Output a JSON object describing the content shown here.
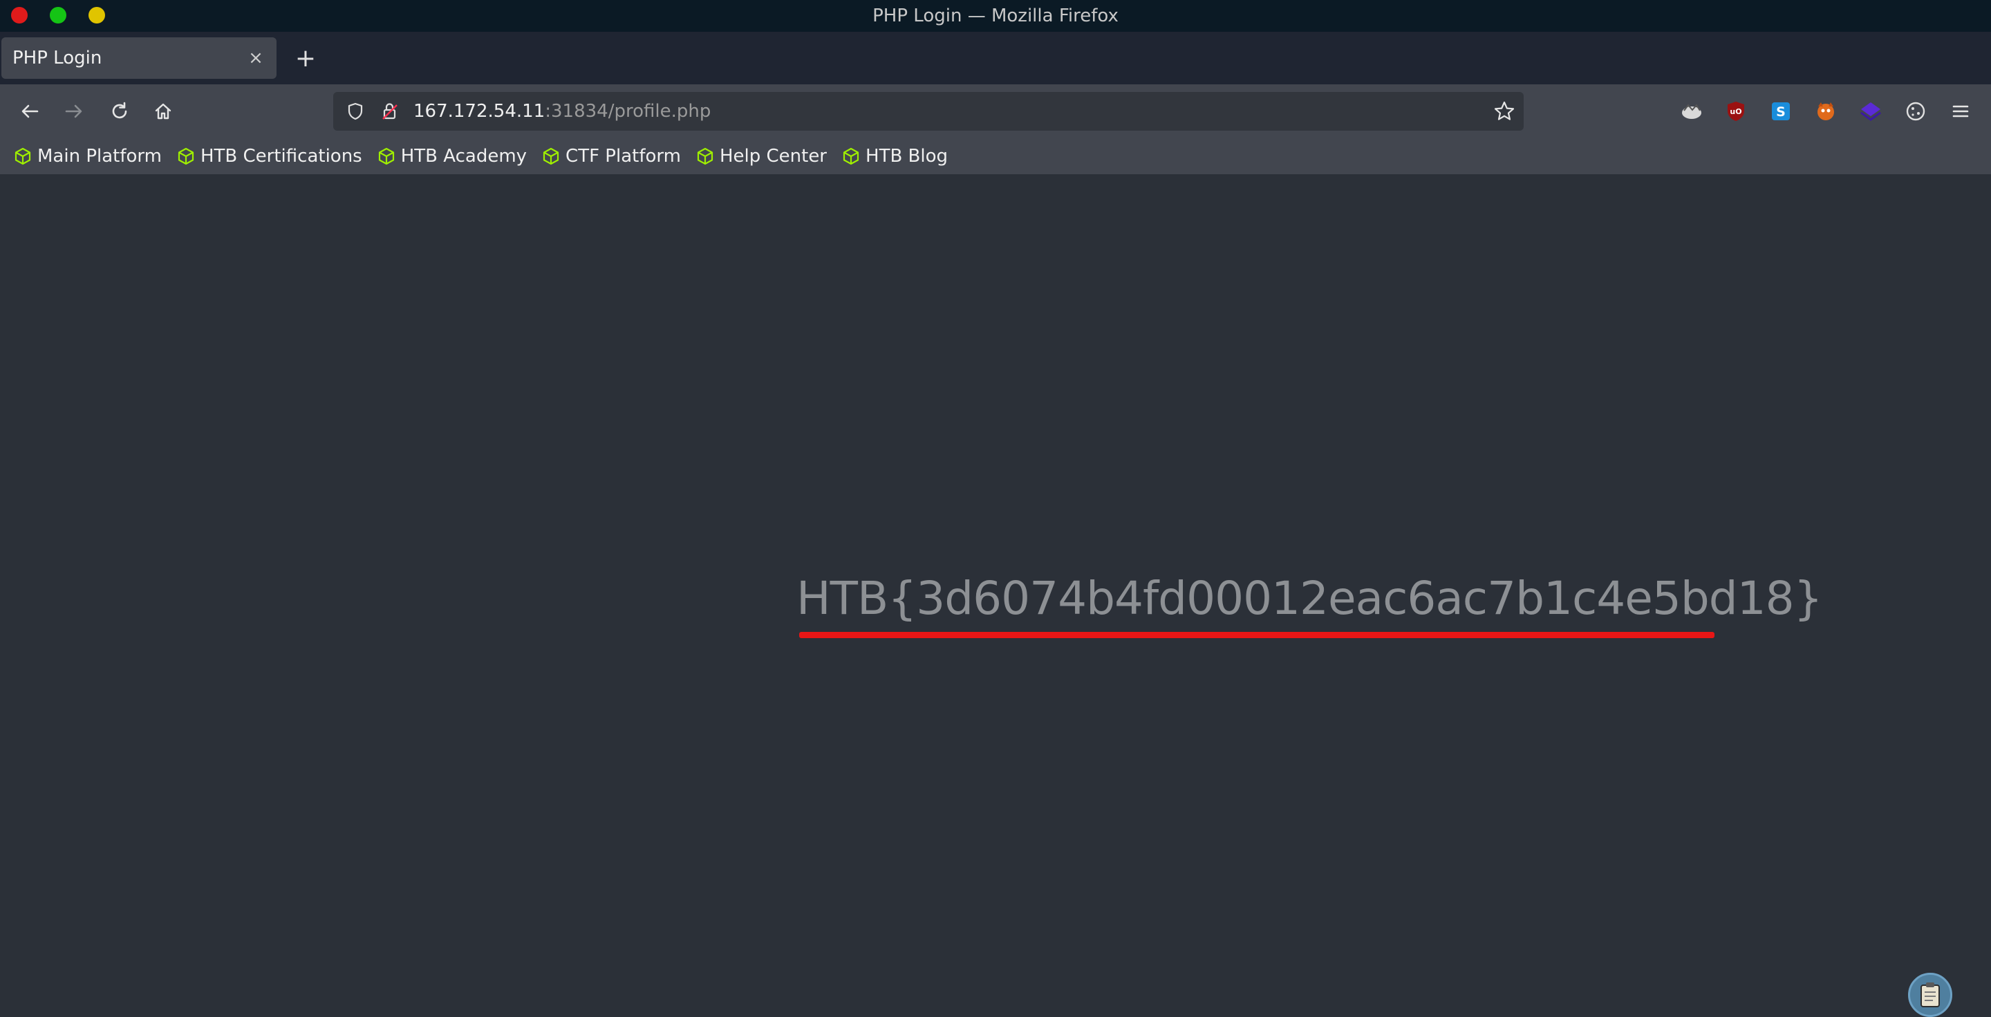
{
  "window": {
    "title": "PHP Login — Mozilla Firefox"
  },
  "tabs": [
    {
      "label": "PHP Login",
      "close": "×"
    }
  ],
  "newtab": "+",
  "urlbar": {
    "host": "167.172.54.11",
    "rest": ":31834/profile.php"
  },
  "bookmarks": [
    {
      "label": "Main Platform"
    },
    {
      "label": "HTB Certifications"
    },
    {
      "label": "HTB Academy"
    },
    {
      "label": "CTF Platform"
    },
    {
      "label": "Help Center"
    },
    {
      "label": "HTB Blog"
    }
  ],
  "page": {
    "flag": "HTB{3d6074b4fd00012eac6ac7b1c4e5bd18}"
  },
  "colors": {
    "accent_underline": "#e81616",
    "bookmark_icon": "#9fef00"
  }
}
